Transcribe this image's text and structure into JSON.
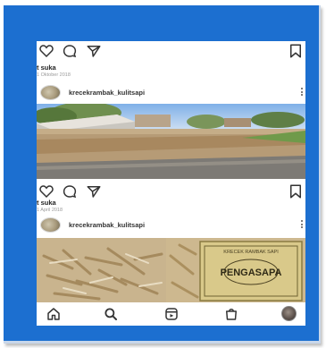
{
  "post1": {
    "likes_text": "t suka",
    "date_text": "1 Oktober 2018",
    "username": "krecekrambak_kulitsapi"
  },
  "post2": {
    "likes_text": "t suka",
    "date_text": "1 April 2018",
    "username": "krecekrambak_kulitsapi",
    "bag_label_top": "KRECEK RAMBAK SAPI",
    "bag_label_brand": "PENGASAPA"
  },
  "action_icons": [
    "heart-icon",
    "comment-icon",
    "share-icon",
    "bookmark-icon"
  ],
  "bottom_nav": [
    "home-icon",
    "search-icon",
    "reels-icon",
    "shop-icon",
    "profile-avatar"
  ],
  "colors": {
    "frame_blue": "#1c6fd0",
    "screen_bg": "#ffffff",
    "icon": "#333333"
  }
}
